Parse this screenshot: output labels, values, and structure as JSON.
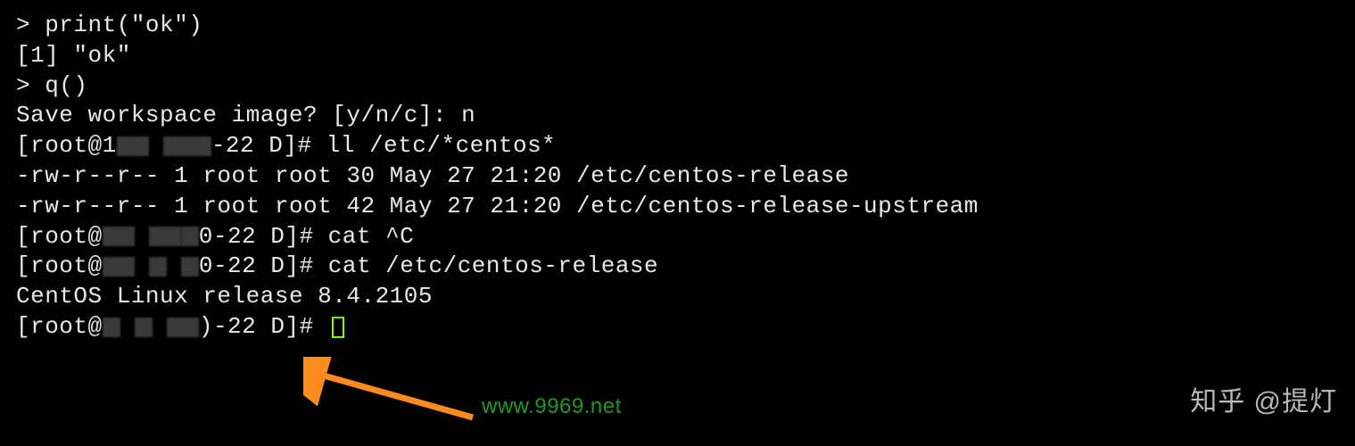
{
  "lines": {
    "l1": "> print(\"ok\")",
    "l2": "[1] \"ok\"",
    "l3": "> q()",
    "l4": "Save workspace image? [y/n/c]: n",
    "p1_a": "[root@1",
    "p1_b": "-22 D]# ll /etc/*centos*",
    "l6": "-rw-r--r-- 1 root root 30 May 27 21:20 /etc/centos-release",
    "l7": "-rw-r--r-- 1 root root 42 May 27 21:20 /etc/centos-release-upstream",
    "p2_a": "[root@",
    "p2_b": "0-22 D]# cat ^C",
    "p3_a": "[root@",
    "p3_b": "0-22 D]# cat /etc/centos-release",
    "l10": "CentOS Linux release 8.4.2105",
    "p4_a": "[root@",
    "p4_b": ")-22 D]# "
  },
  "watermark_url": "www.9969.net",
  "watermark_zhihu": "知乎 @提灯",
  "cursor_color": "#7fff00",
  "arrow_color": "#ff8c1a"
}
